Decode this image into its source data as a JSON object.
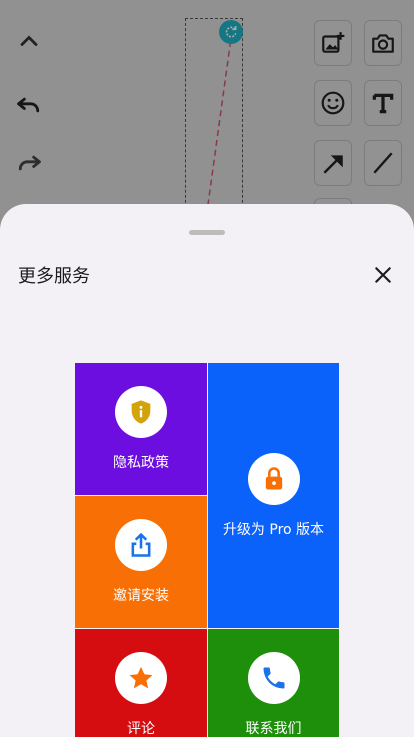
{
  "sheet": {
    "title": "更多服务",
    "tiles": {
      "privacy": {
        "label": "隐私政策",
        "icon": "shield-info-icon",
        "color": "#6d0ee0",
        "icon_color": "#d4a30a"
      },
      "upgrade": {
        "label": "升级为 Pro 版本",
        "icon": "lock-icon",
        "color": "#0a62fb",
        "icon_color": "#f76f05"
      },
      "invite": {
        "label": "邀请安装",
        "icon": "share-icon",
        "color": "#f76f05",
        "icon_color": "#1a73e8"
      },
      "review": {
        "label": "评论",
        "icon": "star-icon",
        "color": "#d50d10",
        "icon_color": "#f76f05"
      },
      "contact": {
        "label": "联系我们",
        "icon": "phone-icon",
        "color": "#1d8f0a",
        "icon_color": "#1a73e8"
      }
    }
  },
  "background_tools": {
    "left": [
      "collapse-icon",
      "undo-icon",
      "redo-icon"
    ],
    "right": [
      "add-image-icon",
      "camera-icon",
      "emoji-icon",
      "text-icon",
      "arrow-icon",
      "line-icon"
    ]
  }
}
